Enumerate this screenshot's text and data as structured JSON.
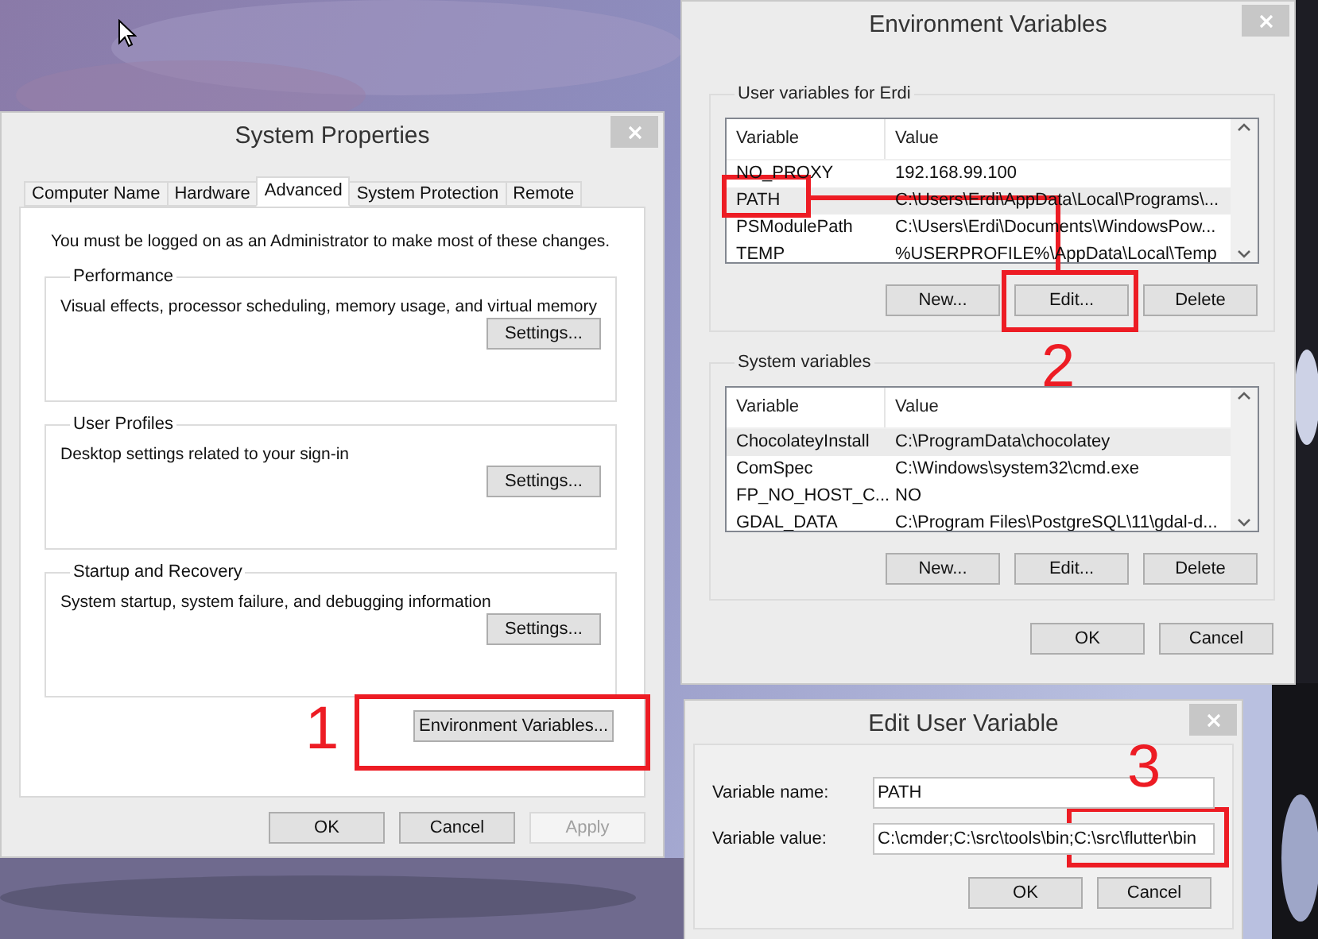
{
  "system_properties": {
    "title": "System Properties",
    "tabs": [
      {
        "label": "Computer Name",
        "selected": false
      },
      {
        "label": "Hardware",
        "selected": false
      },
      {
        "label": "Advanced",
        "selected": true
      },
      {
        "label": "System Protection",
        "selected": false
      },
      {
        "label": "Remote",
        "selected": false
      }
    ],
    "notice": "You must be logged on as an Administrator to make most of these changes.",
    "groups": [
      {
        "title": "Performance",
        "description": "Visual effects, processor scheduling, memory usage, and virtual memory",
        "button": "Settings..."
      },
      {
        "title": "User Profiles",
        "description": "Desktop settings related to your sign-in",
        "button": "Settings..."
      },
      {
        "title": "Startup and Recovery",
        "description": "System startup, system failure, and debugging information",
        "button": "Settings..."
      }
    ],
    "environment_button": "Environment Variables...",
    "buttons": [
      {
        "label": "OK",
        "disabled": false
      },
      {
        "label": "Cancel",
        "disabled": false
      },
      {
        "label": "Apply",
        "disabled": true
      }
    ]
  },
  "environment_variables": {
    "title": "Environment Variables",
    "lists": [
      {
        "title": "User variables for Erdi",
        "columns": [
          "Variable",
          "Value"
        ],
        "rows": [
          {
            "variable": "NO_PROXY",
            "value": "192.168.99.100",
            "selected": false
          },
          {
            "variable": "PATH",
            "value": "C:\\Users\\Erdi\\AppData\\Local\\Programs\\...",
            "selected": true
          },
          {
            "variable": "PSModulePath",
            "value": "C:\\Users\\Erdi\\Documents\\WindowsPow...",
            "selected": false
          },
          {
            "variable": "TEMP",
            "value": "%USERPROFILE%\\AppData\\Local\\Temp",
            "selected": false
          }
        ],
        "buttons": [
          "New...",
          "Edit...",
          "Delete"
        ]
      },
      {
        "title": "System variables",
        "columns": [
          "Variable",
          "Value"
        ],
        "rows": [
          {
            "variable": "ChocolateyInstall",
            "value": "C:\\ProgramData\\chocolatey",
            "selected": true
          },
          {
            "variable": "ComSpec",
            "value": "C:\\Windows\\system32\\cmd.exe",
            "selected": false
          },
          {
            "variable": "FP_NO_HOST_C...",
            "value": "NO",
            "selected": false
          },
          {
            "variable": "GDAL_DATA",
            "value": "C:\\Program Files\\PostgreSQL\\11\\gdal-d...",
            "selected": false
          }
        ],
        "buttons": [
          "New...",
          "Edit...",
          "Delete"
        ]
      }
    ],
    "buttons": [
      "OK",
      "Cancel"
    ]
  },
  "edit_user_variable": {
    "title": "Edit User Variable",
    "fields": [
      {
        "label": "Variable name:",
        "value": "PATH"
      },
      {
        "label": "Variable value:",
        "value": "C:\\cmder;C:\\src\\tools\\bin;C:\\src\\flutter\\bin"
      }
    ],
    "buttons": [
      "OK",
      "Cancel"
    ]
  },
  "annotations": [
    {
      "label": "1"
    },
    {
      "label": "2"
    },
    {
      "label": "3"
    }
  ]
}
